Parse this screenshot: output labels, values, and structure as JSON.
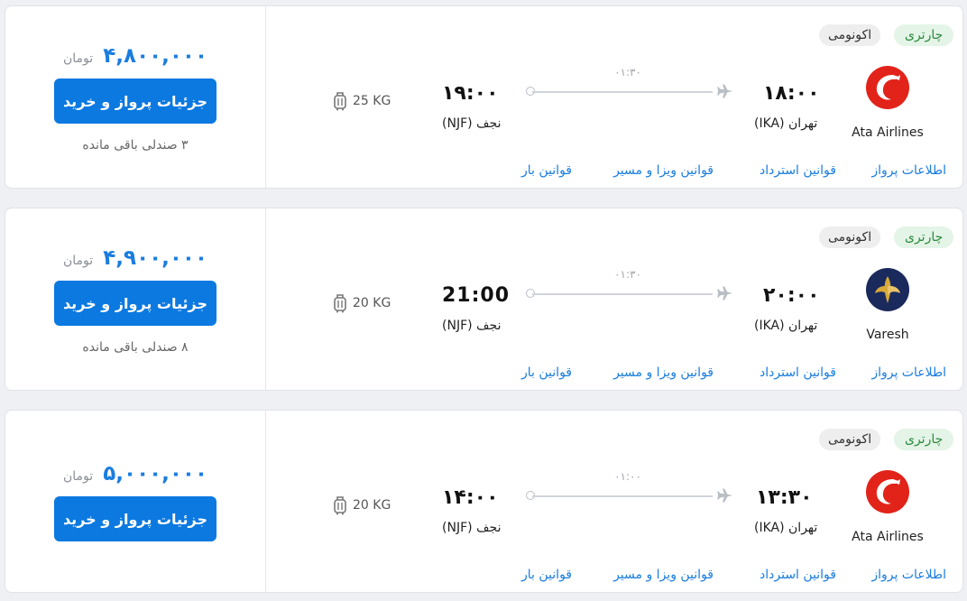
{
  "currency_label": "تومان",
  "buy_label": "جزئیات پرواز و خرید",
  "baggage_icon": "luggage-icon",
  "plane_icon": "airplane-icon",
  "links": {
    "flight_info": "اطلاعات پرواز",
    "refund_rules": "قوانین استرداد",
    "visa_rules": "قوانین ویزا و مسیر",
    "baggage_rules": "قوانین بار"
  },
  "colors": {
    "accent": "#0b79e0",
    "charter_bg": "#e4f4e7",
    "charter_text": "#2c8a3f"
  },
  "flights": [
    {
      "price": "۴,۸۰۰,۰۰۰",
      "seats_left": "۳ صندلی باقی مانده",
      "baggage": "25 KG",
      "departure_time": "۱۸:۰۰",
      "arrival_time": "۱۹:۰۰",
      "origin": "تهران (IKA)",
      "destination": "نجف (NJF)",
      "duration": "۰۱:۳۰",
      "flight_type": "چارتری",
      "cabin_class": "اکونومی",
      "airline": "Ata Airlines"
    },
    {
      "price": "۴,۹۰۰,۰۰۰",
      "seats_left": "۸ صندلی باقی مانده",
      "baggage": "20 KG",
      "departure_time": "۲۰:۰۰",
      "arrival_time": "21:00",
      "origin": "تهران (IKA)",
      "destination": "نجف (NJF)",
      "duration": "۰۱:۳۰",
      "flight_type": "چارتری",
      "cabin_class": "اکونومی",
      "airline": "Varesh"
    },
    {
      "price": "۵,۰۰۰,۰۰۰",
      "seats_left": "",
      "baggage": "20 KG",
      "departure_time": "۱۳:۳۰",
      "arrival_time": "۱۴:۰۰",
      "origin": "تهران (IKA)",
      "destination": "نجف (NJF)",
      "duration": "۰۱:۰۰",
      "flight_type": "چارتری",
      "cabin_class": "اکونومی",
      "airline": "Ata Airlines"
    }
  ]
}
